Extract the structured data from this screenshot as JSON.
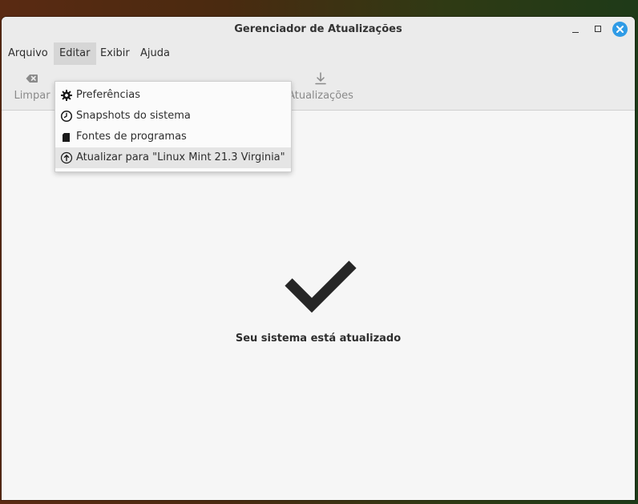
{
  "window": {
    "title": "Gerenciador de Atualizações"
  },
  "menubar": {
    "items": [
      {
        "label": "Arquivo"
      },
      {
        "label": "Editar"
      },
      {
        "label": "Exibir"
      },
      {
        "label": "Ajuda"
      }
    ],
    "active": "Editar"
  },
  "toolbar": {
    "clear_label": "Limpar",
    "updates_label": "Atualizações"
  },
  "edit_menu": {
    "items": [
      {
        "label": "Preferências",
        "icon": "gear-icon"
      },
      {
        "label": "Snapshots do sistema",
        "icon": "clock-icon"
      },
      {
        "label": "Fontes de programas",
        "icon": "package-icon"
      },
      {
        "label": "Atualizar para \"Linux Mint 21.3 Virginia\"",
        "icon": "upgrade-arrow-icon"
      }
    ],
    "hovered_index": 3
  },
  "status": {
    "message": "Seu sistema está atualizado",
    "icon": "checkmark-icon"
  },
  "colors": {
    "close_button": "#2f9be6",
    "menu_active": "#d6d6d6"
  }
}
